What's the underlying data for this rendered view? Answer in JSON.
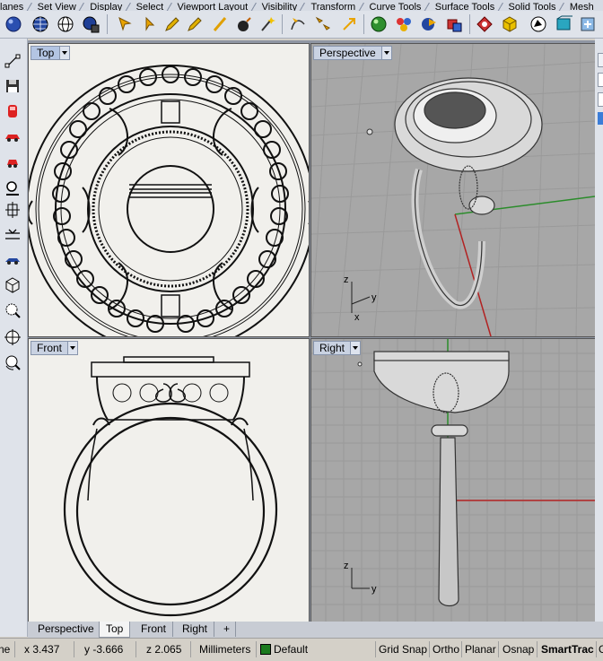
{
  "menu_tabs": [
    "lanes",
    "Set View",
    "Display",
    "Select",
    "Viewport Layout",
    "Visibility",
    "Transform",
    "Curve Tools",
    "Surface Tools",
    "Solid Tools",
    "Mesh"
  ],
  "toolbar_icons": [
    "sphere-icon",
    "sphere-grid-icon",
    "sphere-wire-icon",
    "globe-save-icon",
    "cursor-point-icon",
    "cursor-arrow-icon",
    "pencil-icon",
    "line-icon",
    "bomb-icon",
    "wand-icon",
    "curve-arrow-icon",
    "select-arrows-icon",
    "transform-icon",
    "render-sphere-icon",
    "materials-icon",
    "surface-icon",
    "solid-box-icon",
    "gear-render-icon",
    "cube-icon",
    "rhino-icon",
    "box-edit-icon",
    "misc-icon"
  ],
  "left_icons": [
    "point-icon",
    "save-icon",
    "car-red-icon",
    "car-icon",
    "car-small-icon",
    "zoom-icon",
    "gumball-icon",
    "flatten-icon",
    "orbit-car-icon",
    "view-cube-icon",
    "zoom-window-icon",
    "crosshair-icon",
    "zoom-rotate-icon"
  ],
  "viewports": {
    "top": {
      "label": "Top"
    },
    "perspective": {
      "label": "Perspective"
    },
    "front": {
      "label": "Front"
    },
    "right": {
      "label": "Right"
    }
  },
  "axes": {
    "z": "z",
    "y": "y",
    "x": "x"
  },
  "viewport_tabs": [
    "Perspective",
    "Top",
    "Front",
    "Right"
  ],
  "add_tab_symbol": "+",
  "status": {
    "units_fragment": "ne",
    "x": "x 3.437",
    "y": "y -3.666",
    "z": "z 2.065",
    "units": "Millimeters",
    "layer": "Default",
    "grid_snap": "Grid Snap",
    "ortho": "Ortho",
    "planar": "Planar",
    "osnap": "Osnap",
    "smarttrack": "SmartTrac",
    "extra": "G"
  },
  "colors": {
    "grid_bg": "#a7a7a7",
    "drawing_bg": "#f1f0ec",
    "x_axis": "#b22222",
    "y_axis": "#228b22",
    "layer": "#1b7a1e"
  }
}
